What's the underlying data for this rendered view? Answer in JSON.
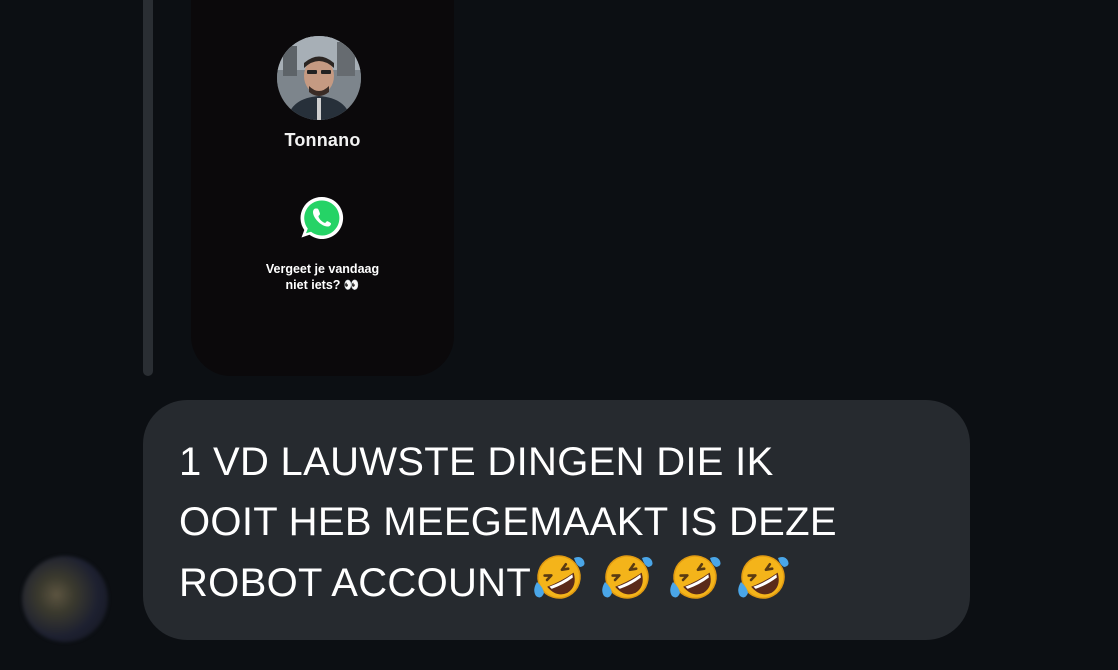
{
  "story": {
    "profile_name": "Tonnano",
    "message_line1": "Vergeet je vandaag",
    "message_line2": "niet iets? 👀",
    "icon": "whatsapp-icon"
  },
  "message": {
    "line1": "1 VD LAUWSTE DINGEN DIE IK",
    "line2": "OOIT HEB MEEGEMAAKT IS DEZE",
    "line3": "ROBOT ACCOUNT",
    "emoji_name": "rolling-on-the-floor-laughing",
    "emoji_count": 4
  },
  "colors": {
    "background": "#0c0f13",
    "bubble": "#262a2f",
    "story_card": "#0b090b",
    "whatsapp_green": "#25d366"
  }
}
